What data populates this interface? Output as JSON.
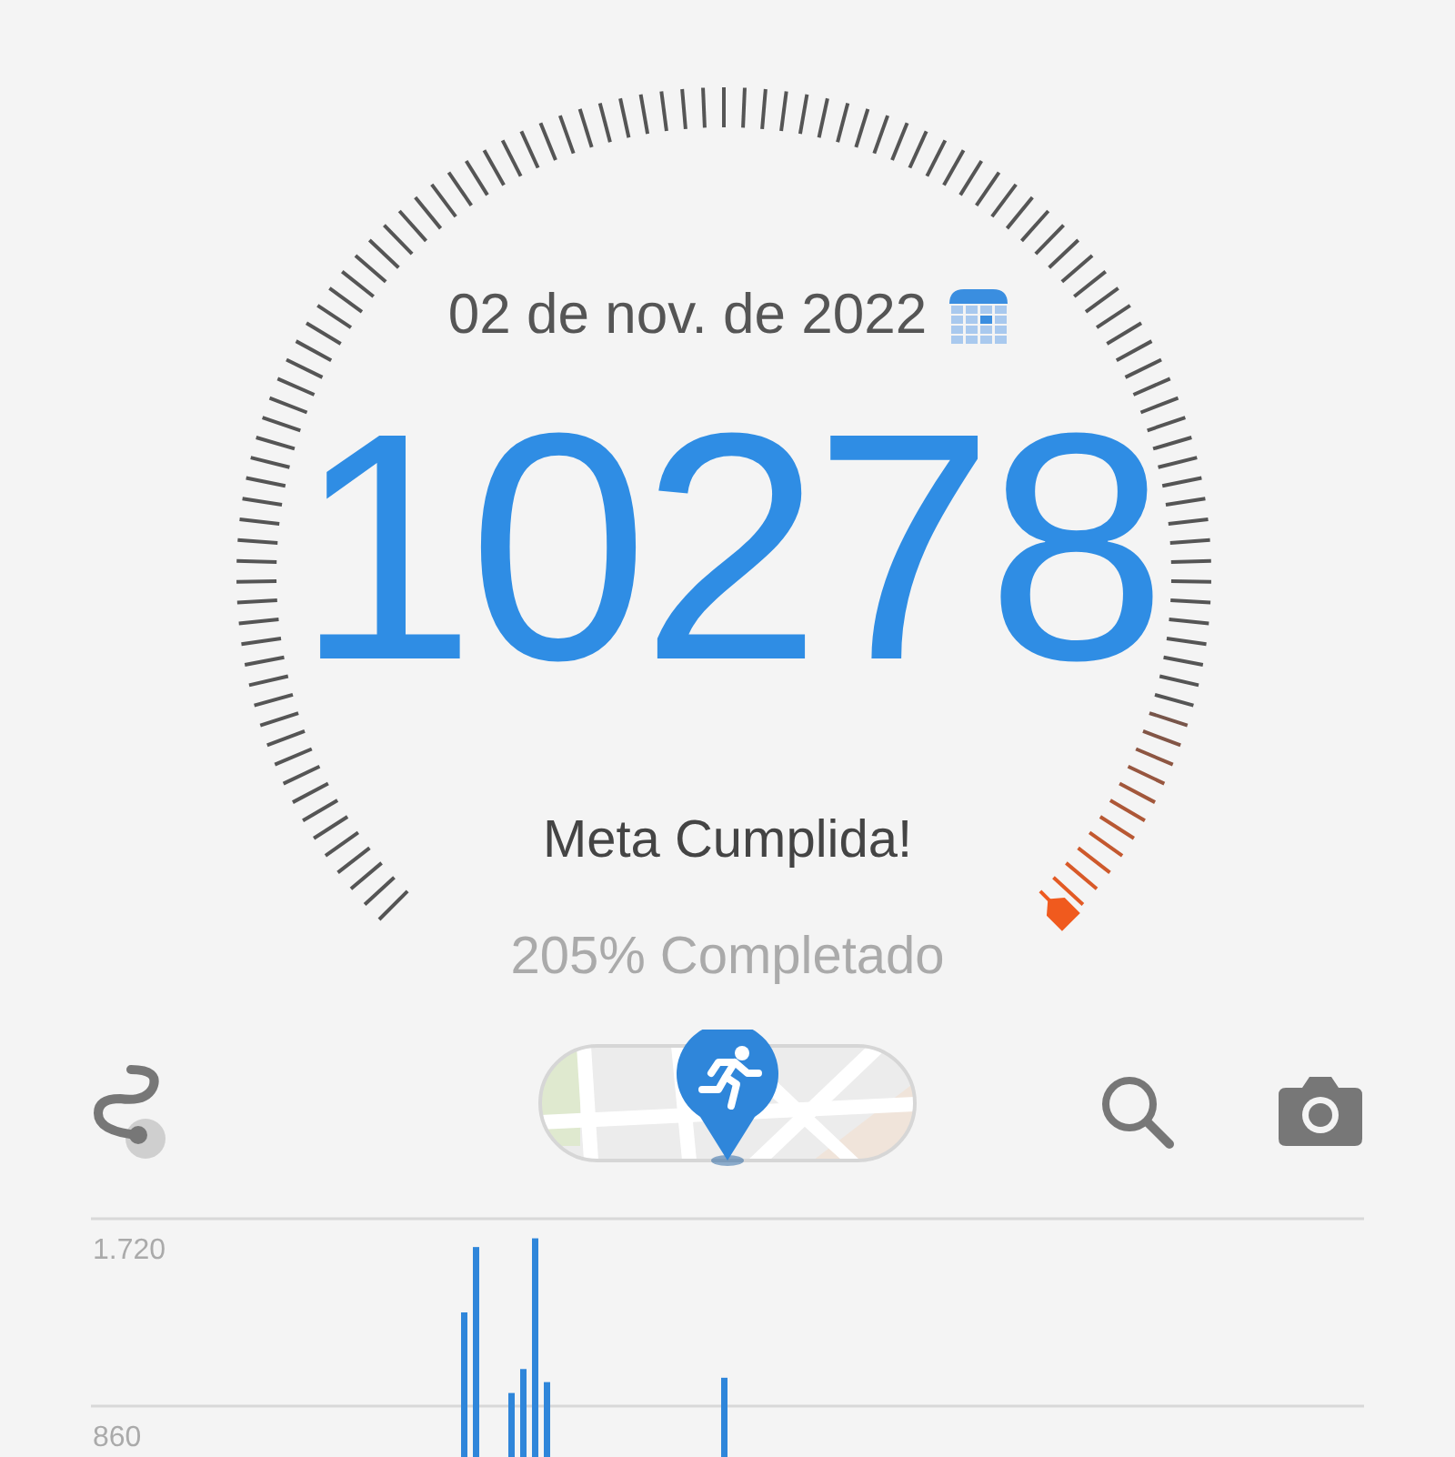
{
  "date": "02 de nov. de 2022",
  "steps": "10278",
  "status": "Meta Cumplida!",
  "progress": "205% Completado",
  "chart_data": {
    "type": "bar",
    "ylim": [
      0,
      1720
    ],
    "yticks": [
      {
        "value": 860,
        "label": "860"
      },
      {
        "value": 1720,
        "label": "1.720"
      }
    ],
    "values": [
      null,
      null,
      null,
      null,
      null,
      null,
      null,
      null,
      null,
      null,
      null,
      null,
      null,
      null,
      null,
      null,
      null,
      null,
      null,
      null,
      null,
      null,
      null,
      null,
      null,
      null,
      null,
      null,
      null,
      null,
      null,
      1290,
      1590,
      null,
      null,
      920,
      1030,
      1630,
      970,
      null,
      null,
      null,
      null,
      null,
      null,
      null,
      null,
      null,
      null,
      null,
      null,
      null,
      null,
      990,
      null,
      null,
      null,
      null,
      null,
      null,
      null,
      null,
      null,
      null,
      null,
      null,
      null,
      null,
      null,
      null,
      null,
      null,
      null,
      null,
      null,
      null,
      null,
      null,
      null,
      null,
      null,
      null,
      null,
      null,
      null,
      null,
      null,
      null,
      null,
      null,
      null,
      null,
      null,
      null,
      null,
      null,
      null,
      null,
      null,
      null,
      null,
      null,
      null,
      null,
      null,
      null,
      null,
      null
    ]
  }
}
